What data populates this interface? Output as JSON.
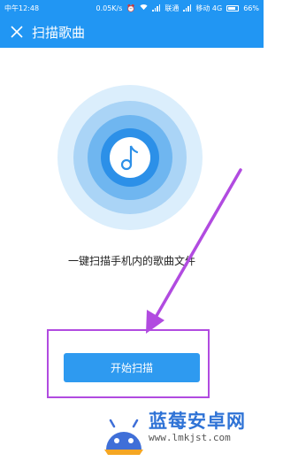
{
  "status_bar": {
    "time": "中午12:48",
    "speed": "0.05K/s",
    "carrier1": "联通",
    "carrier2": "移动 4G",
    "battery": "66%"
  },
  "app_bar": {
    "title": "扫描歌曲"
  },
  "main": {
    "icon": "music-note-icon",
    "prompt": "一键扫描手机内的歌曲文件",
    "start_button": "开始扫描"
  },
  "annotation_color": "#b14be0",
  "accent_color": "#2196f3",
  "watermark": {
    "title": "蓝莓安卓网",
    "url": "www.lmkjst.com"
  }
}
